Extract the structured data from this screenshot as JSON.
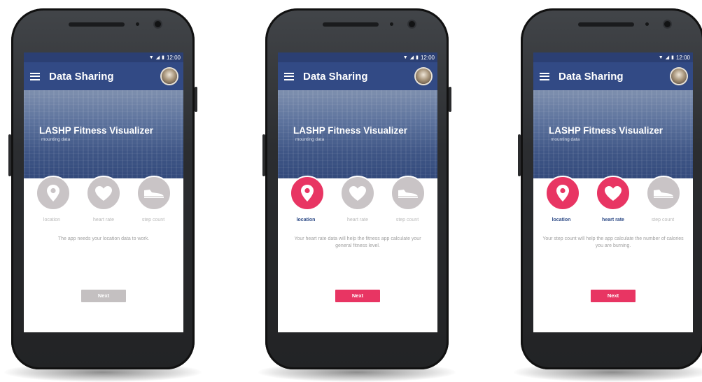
{
  "status_bar": {
    "time": "12:00"
  },
  "colors": {
    "accent": "#e83563",
    "appbar": "#324a85",
    "inactive": "#c9c4c6"
  },
  "icons": [
    "menu-icon",
    "avatar",
    "location-pin-icon",
    "heart-icon",
    "shoe-icon",
    "wifi-icon",
    "signal-icon",
    "battery-icon"
  ],
  "screens": [
    {
      "app_bar": {
        "title": "Data Sharing"
      },
      "hero": {
        "title": "LASHP Fitness Visualizer",
        "subtitle": "mounting data"
      },
      "permissions": [
        {
          "label": "location",
          "active": false
        },
        {
          "label": "heart rate",
          "active": false
        },
        {
          "label": "step count",
          "active": false
        }
      ],
      "description": "The app needs your location data to work.",
      "next_label": "Next",
      "next_enabled": false
    },
    {
      "app_bar": {
        "title": "Data Sharing"
      },
      "hero": {
        "title": "LASHP Fitness Visualizer",
        "subtitle": "mounting data"
      },
      "permissions": [
        {
          "label": "location",
          "active": true
        },
        {
          "label": "heart rate",
          "active": false
        },
        {
          "label": "step count",
          "active": false
        }
      ],
      "description": "Your heart rate data will help the fitness app calculate your general fitness level.",
      "next_label": "Next",
      "next_enabled": true
    },
    {
      "app_bar": {
        "title": "Data Sharing"
      },
      "hero": {
        "title": "LASHP Fitness Visualizer",
        "subtitle": "mounting data"
      },
      "permissions": [
        {
          "label": "location",
          "active": true
        },
        {
          "label": "heart rate",
          "active": true
        },
        {
          "label": "step count",
          "active": false
        }
      ],
      "description": "Your step count will help the app calculate the number of calories you are burning.",
      "next_label": "Next",
      "next_enabled": true
    }
  ]
}
